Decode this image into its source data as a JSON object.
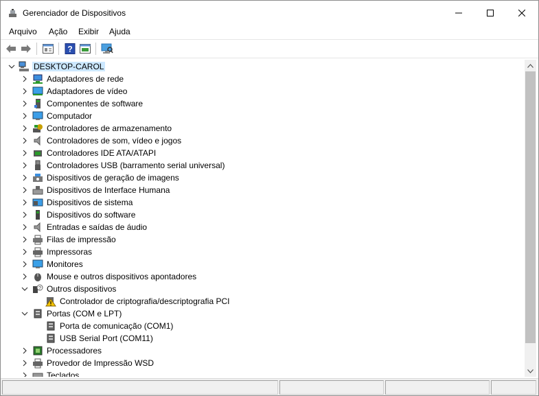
{
  "window": {
    "title": "Gerenciador de Dispositivos"
  },
  "menu": [
    "Arquivo",
    "Ação",
    "Exibir",
    "Ajuda"
  ],
  "toolbar_icons": [
    "back-arrow-icon",
    "forward-arrow-icon",
    "properties-icon",
    "help-icon",
    "update-driver-icon",
    "scan-hardware-icon"
  ],
  "tree": {
    "root": "DESKTOP-CAROL",
    "items": [
      {
        "label": "Adaptadores de rede",
        "icon": "network-adapter-icon"
      },
      {
        "label": "Adaptadores de vídeo",
        "icon": "display-adapter-icon"
      },
      {
        "label": "Componentes de software",
        "icon": "software-component-icon"
      },
      {
        "label": "Computador",
        "icon": "computer-icon"
      },
      {
        "label": "Controladores de armazenamento",
        "icon": "storage-controller-icon"
      },
      {
        "label": "Controladores de som, vídeo e jogos",
        "icon": "speaker-icon"
      },
      {
        "label": "Controladores IDE ATA/ATAPI",
        "icon": "ide-controller-icon"
      },
      {
        "label": "Controladores USB (barramento serial universal)",
        "icon": "usb-icon"
      },
      {
        "label": "Dispositivos de geração de imagens",
        "icon": "imaging-device-icon"
      },
      {
        "label": "Dispositivos de Interface Humana",
        "icon": "hid-icon"
      },
      {
        "label": "Dispositivos de sistema",
        "icon": "system-device-icon"
      },
      {
        "label": "Dispositivos do software",
        "icon": "software-device-icon"
      },
      {
        "label": "Entradas e saídas de áudio",
        "icon": "audio-io-icon"
      },
      {
        "label": "Filas de impressão",
        "icon": "print-queue-icon"
      },
      {
        "label": "Impressoras",
        "icon": "printer-icon"
      },
      {
        "label": "Monitores",
        "icon": "monitor-icon"
      },
      {
        "label": "Mouse e outros dispositivos apontadores",
        "icon": "mouse-icon"
      },
      {
        "label": "Outros dispositivos",
        "icon": "unknown-device-icon",
        "expanded": true,
        "children": [
          {
            "label": "Controlador de criptografia/descriptografia PCI",
            "icon": "warning-device-icon"
          }
        ]
      },
      {
        "label": "Portas (COM e LPT)",
        "icon": "port-icon",
        "expanded": true,
        "children": [
          {
            "label": "Porta de comunicação (COM1)",
            "icon": "port-icon"
          },
          {
            "label": "USB Serial Port (COM11)",
            "icon": "port-icon"
          }
        ]
      },
      {
        "label": "Processadores",
        "icon": "processor-icon"
      },
      {
        "label": "Provedor de Impressão WSD",
        "icon": "wsd-printer-icon"
      },
      {
        "label": "Teclados",
        "icon": "keyboard-icon"
      }
    ]
  }
}
